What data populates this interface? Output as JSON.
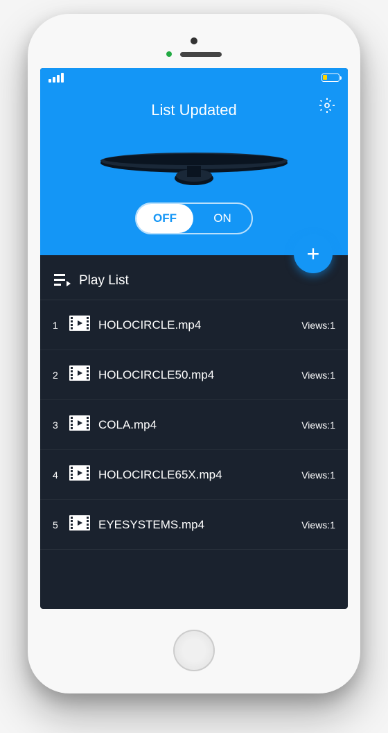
{
  "header": {
    "title": "List Updated"
  },
  "toggle": {
    "off_label": "OFF",
    "on_label": "ON",
    "state": "off"
  },
  "playlist": {
    "title": "Play List",
    "views_prefix": "Views:",
    "items": [
      {
        "index": "1",
        "name": "HOLOCIRCLE.mp4",
        "views": "Views:1"
      },
      {
        "index": "2",
        "name": "HOLOCIRCLE50.mp4",
        "views": "Views:1"
      },
      {
        "index": "3",
        "name": "COLA.mp4",
        "views": "Views:1"
      },
      {
        "index": "4",
        "name": "HOLOCIRCLE65X.mp4",
        "views": "Views:1"
      },
      {
        "index": "5",
        "name": "EYESYSTEMS.mp4",
        "views": "Views:1"
      }
    ]
  },
  "colors": {
    "accent": "#1496f6",
    "dark": "#1a222e"
  }
}
